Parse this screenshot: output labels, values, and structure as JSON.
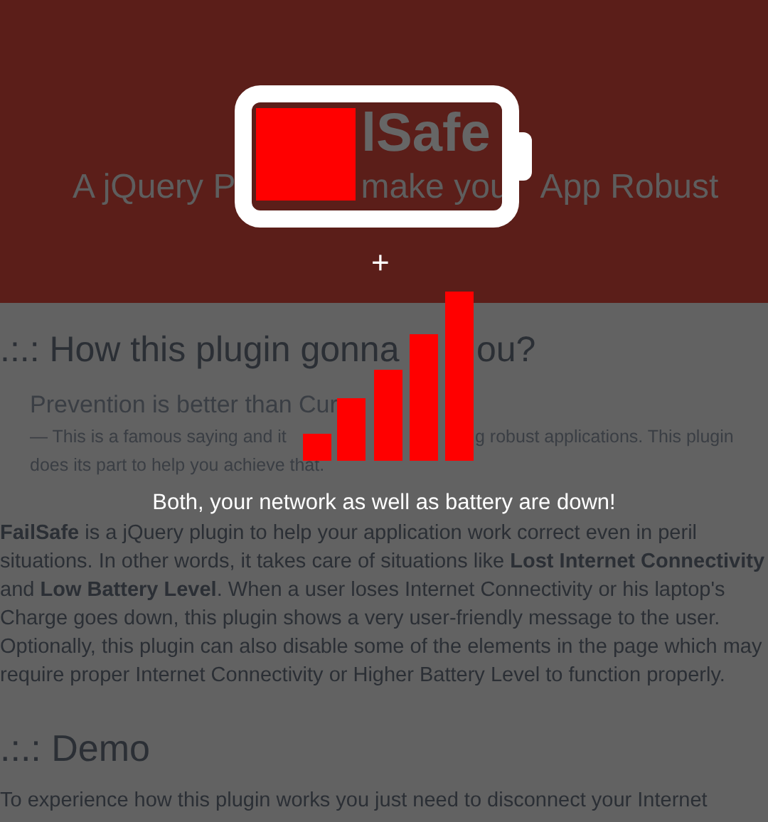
{
  "header": {
    "title_visible": "lSafe",
    "subtitle_fragments": [
      "A jQuery P",
      "make you",
      "App Robust"
    ]
  },
  "alert": {
    "battery": {
      "low": true
    },
    "separator": "+",
    "network": {
      "down": true
    },
    "message": "Both, your network as well as battery are down!"
  },
  "section_1": {
    "heading_fragments": [
      ".:.: How this plugin gonna",
      "ou?"
    ],
    "quote": {
      "title": "Prevention is better than Cur",
      "line_1_fragments": [
        "— This is a famous saying and it",
        "g robust applications. This plugin"
      ],
      "line_2": "does its part to help you achieve that."
    },
    "paragraph": "**FailSafe** is a jQuery plugin to help your application work correct even in peril situations. In other words, it takes care of situations like **Lost Internet Connectivity** and **Low Battery Level**. When a user loses Internet Connectivity or his laptop's Charge goes down, this plugin shows a very user-friendly message to the user. Optionally, this plugin can also disable some of the elements in the page which may require proper Internet Connectivity or Higher Battery Level to function properly."
  },
  "section_2": {
    "heading": ".:.: Demo",
    "paragraph": "To experience how this plugin works you just need to disconnect your Internet"
  }
}
